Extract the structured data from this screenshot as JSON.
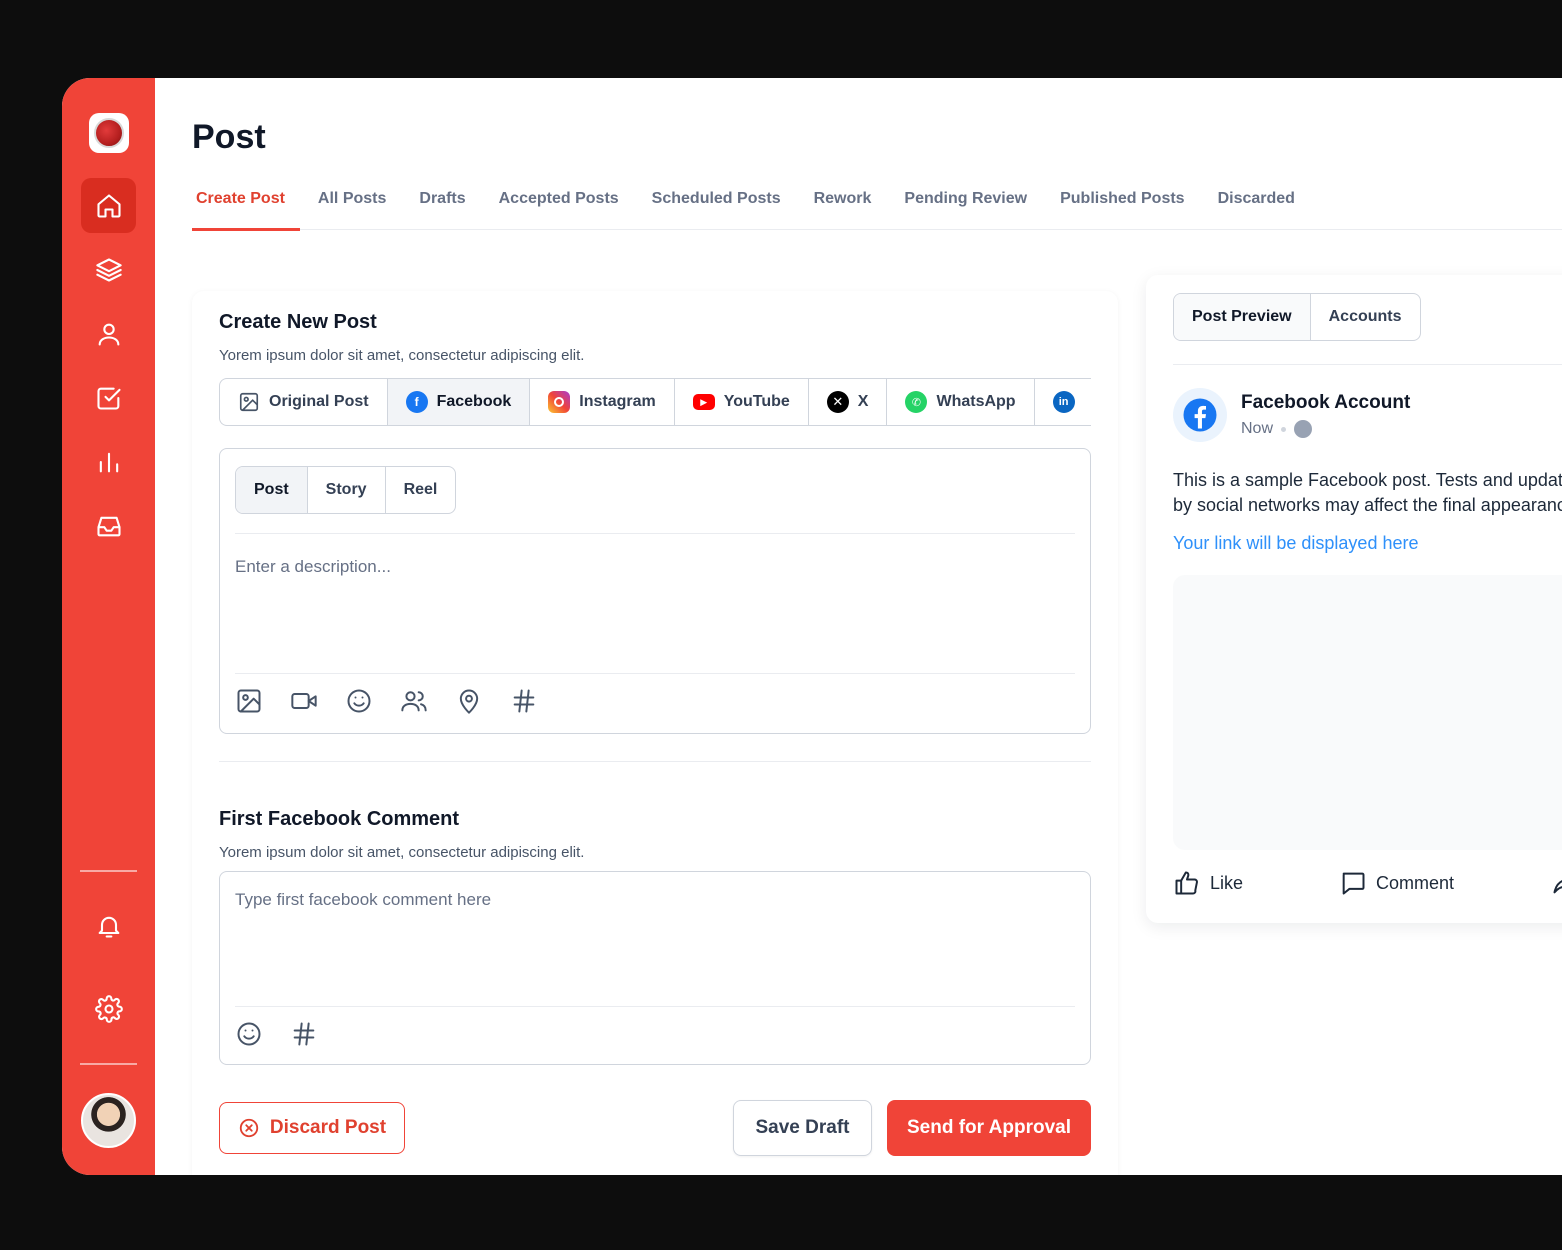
{
  "page": {
    "title": "Post"
  },
  "tabs": [
    {
      "label": "Create Post",
      "active": true
    },
    {
      "label": "All Posts"
    },
    {
      "label": "Drafts"
    },
    {
      "label": "Accepted Posts"
    },
    {
      "label": "Scheduled Posts"
    },
    {
      "label": "Rework"
    },
    {
      "label": "Pending Review"
    },
    {
      "label": "Published Posts"
    },
    {
      "label": "Discarded"
    }
  ],
  "sidebar": {
    "icons": [
      "home-icon",
      "layers-icon",
      "user-icon",
      "checkbox-icon",
      "bar-chart-icon",
      "inbox-icon",
      "bell-icon",
      "gear-icon"
    ]
  },
  "create": {
    "title": "Create New Post",
    "subtitle": "Yorem ipsum dolor sit amet, consectetur adipiscing elit.",
    "platforms": [
      {
        "label": "Original Post",
        "icon": "image-icon"
      },
      {
        "label": "Facebook",
        "icon": "facebook-icon",
        "active": true
      },
      {
        "label": "Instagram",
        "icon": "instagram-icon"
      },
      {
        "label": "YouTube",
        "icon": "youtube-icon"
      },
      {
        "label": "X",
        "icon": "x-icon"
      },
      {
        "label": "WhatsApp",
        "icon": "whatsapp-icon"
      }
    ],
    "post_types": [
      {
        "label": "Post",
        "active": true
      },
      {
        "label": "Story"
      },
      {
        "label": "Reel"
      }
    ],
    "description_placeholder": "Enter a description..."
  },
  "comment": {
    "title": "First Facebook Comment",
    "subtitle": "Yorem ipsum dolor sit amet, consectetur adipiscing elit.",
    "placeholder": "Type first facebook comment here"
  },
  "actions": {
    "discard": "Discard Post",
    "save_draft": "Save Draft",
    "send": "Send for Approval"
  },
  "preview": {
    "tabs": [
      {
        "label": "Post Preview",
        "active": true
      },
      {
        "label": "Accounts"
      }
    ],
    "account_name": "Facebook Account",
    "time": "Now",
    "text_line1": "This is a sample Facebook post. Tests and updates",
    "text_line2": "by social networks may affect the final appearance.",
    "link": "Your link will be displayed here",
    "like": "Like",
    "comment": "Comment"
  },
  "colors": {
    "brand": "#f04438",
    "facebook": "#1877f2",
    "link": "#2e90fa"
  }
}
